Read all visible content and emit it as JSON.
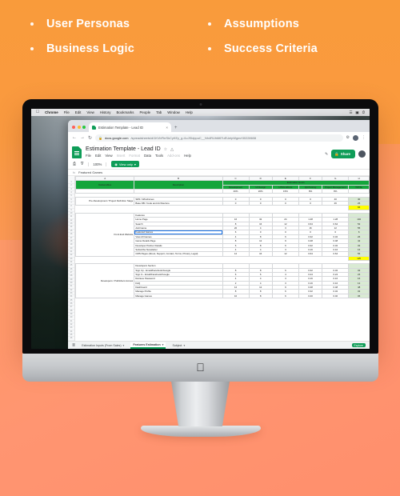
{
  "bullets": [
    {
      "label": "User Personas"
    },
    {
      "label": "Assumptions"
    },
    {
      "label": "Business Logic"
    },
    {
      "label": "Success Criteria"
    }
  ],
  "theme": {
    "orange_top": "#F99B3B",
    "salmon_bottom": "#FF8F6C",
    "sheets_green": "#0F9D58",
    "header_green": "#14A53C",
    "total_fill": "#D9EAD3",
    "highlight_yellow": "#FFFF00"
  },
  "macbar": {
    "apple": "",
    "items": [
      "Chrome",
      "File",
      "Edit",
      "View",
      "History",
      "Bookmarks",
      "People",
      "Tab",
      "Window",
      "Help"
    ],
    "right": [
      "☰",
      "◑",
      "ὐB",
      "⌨",
      "▼",
      "ὐD",
      "≡"
    ]
  },
  "browser": {
    "tab_title": "Estimation Template - Lead ID",
    "tab_close": "×",
    "new_tab": "+",
    "back": "←",
    "forward": "→",
    "reload": "↻",
    "lock_icon": "🔒",
    "url_host": "docs.google.com",
    "url_path": "/spreadsheets/d/1KVbFbrSkCyKEy_g-i1cJSIdppuC__Nh4RUhM6TuEUelpWgm/r30228608",
    "extension_icon": "⚙",
    "menu_icon": "⋮"
  },
  "sheets": {
    "doc_title": "Estimation Template - Lead ID",
    "star_icon": "☆",
    "folder_icon": "△",
    "menu": [
      "File",
      "Edit",
      "View",
      "Insert",
      "Format",
      "Data",
      "Tools",
      "Add-ons",
      "Help"
    ],
    "menu_dim": [
      "Insert",
      "Format",
      "Add-ons"
    ],
    "pencil_icon": "✎",
    "share_label": "Share",
    "share_lock": "🔒",
    "toolbar": {
      "print_icon": "⎙",
      "filter_icon": "∇",
      "zoom": "100%",
      "caret": "▾",
      "view_only_label": "View only",
      "view_only_icon": "◉"
    },
    "formula_bar": {
      "fx": "fx",
      "value": "Featured Games"
    },
    "bottom_tabs": [
      {
        "label": "Estimation Inputs (From Sales)",
        "active": false,
        "caret": "▾"
      },
      {
        "label": "Features Estimation",
        "active": true,
        "caret": "▾"
      },
      {
        "label": "Subject",
        "active": false,
        "caret": "▾"
      }
    ],
    "all_sheets_icon": "≣",
    "add_sheet_icon": "+",
    "explore_label": "Explore"
  },
  "chart_data": {
    "type": "table",
    "title": "Features Estimation",
    "column_letters": [
      "A",
      "B",
      "C",
      "D",
      "E",
      "F",
      "G",
      "H"
    ],
    "group_header": "Estimation Hours",
    "headers": [
      "Deliverables",
      "Description",
      "Development",
      "UI Design",
      "HTML Efforts",
      "QC/Testing",
      "Project Management",
      "TOTAL"
    ],
    "pct_row": [
      "",
      "",
      "40%",
      "20%",
      "15%",
      "8%",
      "8%",
      ""
    ],
    "row_numbers": [
      "1",
      "2",
      "3",
      "4",
      "5",
      "6",
      "7",
      "8",
      "9",
      "10",
      "11",
      "12",
      "13",
      "14",
      "15",
      "16",
      "17",
      "18",
      "19",
      "20",
      "21",
      "22",
      "23",
      "24",
      "25",
      "26",
      "27",
      "28",
      "29",
      "30",
      "31",
      "32",
      "33",
      "34",
      "35",
      "36",
      "37",
      "38",
      "39",
      "40",
      "41",
      "42",
      "43",
      "44",
      "45",
      "46",
      "47",
      "48",
      "49",
      "50",
      "51",
      "52",
      "53",
      "54",
      "55",
      "56",
      "57",
      "58",
      "59",
      "60",
      "61",
      "62"
    ],
    "sections": [
      {
        "label": "Pre-Development / Project Definition Stage",
        "rows": [
          {
            "desc": "SRS / Wireframes",
            "dev": "0",
            "ui": "0",
            "html": "0",
            "qc": "0",
            "pm": "40",
            "total": "40",
            "total_style": "green"
          },
          {
            "desc": "Base DB / Code and Architecture",
            "dev": "0",
            "ui": "0",
            "html": "0",
            "qc": "0",
            "pm": "26",
            "total": "26",
            "total_style": "green"
          }
        ],
        "subtotal": {
          "total": "66",
          "total_style": "yellow"
        }
      },
      {
        "label": "Front End Website",
        "rows": [
          {
            "desc": "Features",
            "header": true,
            "dev": "",
            "ui": "",
            "html": "",
            "qc": "",
            "pm": "",
            "total": "",
            "total_style": "green"
          },
          {
            "desc": "Home Page",
            "dev": "16",
            "ui": "32",
            "html": "24",
            "qc": "1.28",
            "pm": "1.28",
            "total": "104",
            "total_style": "green"
          },
          {
            "desc": "Search",
            "dev": "8",
            "ui": "16",
            "html": "12",
            "qc": "0.64",
            "pm": "0.64",
            "total": "52",
            "total_style": "green"
          },
          {
            "desc": "Add Game",
            "dev": "20",
            "ui": "4",
            "html": "3",
            "qc": "16",
            "pm": "12",
            "total": "55",
            "total_style": "green"
          },
          {
            "desc": "Featured Games",
            "dev": "6",
            "ui": "0",
            "html": "0",
            "qc": "0",
            "pm": "0",
            "total": "6",
            "total_style": "green",
            "selected": true
          },
          {
            "desc": "View All Games",
            "dev": "4",
            "ui": "8",
            "html": "6",
            "qc": "0.32",
            "pm": "0.32",
            "total": "26",
            "total_style": "green"
          },
          {
            "desc": "Game Details Page",
            "dev": "8",
            "ui": "12",
            "html": "9",
            "qc": "0.48",
            "pm": "0.48",
            "total": "42",
            "total_style": "green"
          },
          {
            "desc": "Developer Partner Details",
            "dev": "6",
            "ui": "8",
            "html": "6",
            "qc": "0.32",
            "pm": "0.32",
            "total": "32",
            "total_style": "green"
          },
          {
            "desc": "Subscribe Newsletter",
            "dev": "4",
            "ui": "4",
            "html": "3",
            "qc": "0.16",
            "pm": "0.16",
            "total": "16",
            "total_style": "green"
          },
          {
            "desc": "CMS Pages (About, Support, Contact, Terms, Privacy, Legal)",
            "dev": "12",
            "ui": "16",
            "html": "12",
            "qc": "0.64",
            "pm": "0.64",
            "total": "56",
            "total_style": "green"
          }
        ],
        "subtotal": {
          "total": "125",
          "total_style": "yellow"
        }
      },
      {
        "label": "Developers / Publishers Access",
        "rows": [
          {
            "desc": "Developers Section",
            "header": true,
            "dev": "",
            "ui": "",
            "html": "",
            "qc": "",
            "pm": "",
            "total": "",
            "total_style": "green"
          },
          {
            "desc": "Sign Up - Email/Facebook/Google",
            "dev": "8",
            "ui": "8",
            "html": "6",
            "qc": "0.32",
            "pm": "0.32",
            "total": "32",
            "total_style": "green"
          },
          {
            "desc": "Sign In - Email/Facebook/Google",
            "dev": "6",
            "ui": "6",
            "html": "4",
            "qc": "0.24",
            "pm": "0.24",
            "total": "24",
            "total_style": "green"
          },
          {
            "desc": "Retrieve Password",
            "dev": "4",
            "ui": "4",
            "html": "3",
            "qc": "0.16",
            "pm": "0.16",
            "total": "16",
            "total_style": "green"
          },
          {
            "desc": "FAQ",
            "dev": "2",
            "ui": "4",
            "html": "3",
            "qc": "0.16",
            "pm": "0.16",
            "total": "12",
            "total_style": "green"
          },
          {
            "desc": "Dashboard",
            "dev": "12",
            "ui": "12",
            "html": "9",
            "qc": "0.48",
            "pm": "0.48",
            "total": "48",
            "total_style": "green"
          },
          {
            "desc": "Manage Profile",
            "dev": "8",
            "ui": "8",
            "html": "6",
            "qc": "0.32",
            "pm": "0.32",
            "total": "32",
            "total_style": "green"
          },
          {
            "desc": "Manage Games",
            "dev": "10",
            "ui": "8",
            "html": "6",
            "qc": "0.40",
            "pm": "0.40",
            "total": "36",
            "total_style": "green"
          }
        ]
      }
    ]
  },
  "device": {
    "brand_logo": ""
  }
}
